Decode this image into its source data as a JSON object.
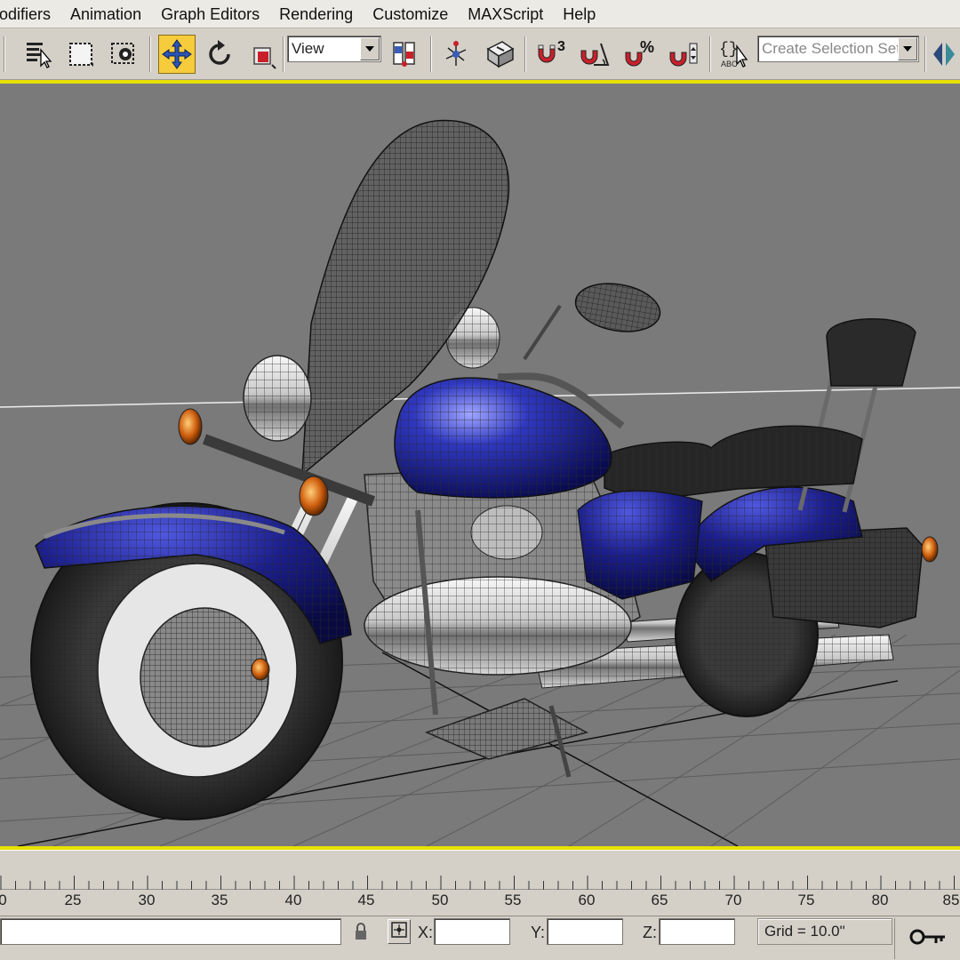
{
  "menu": {
    "items": [
      "odifiers",
      "Animation",
      "Graph Editors",
      "Rendering",
      "Customize",
      "MAXScript",
      "Help"
    ]
  },
  "toolbar": {
    "reference_coord": {
      "value": "View"
    },
    "selection_set": {
      "placeholder": "Create Selection Set"
    },
    "snap_angle_digit": "3",
    "percent_snap_symbol": "%"
  },
  "timeline": {
    "ticks": [
      "0",
      "25",
      "30",
      "35",
      "40",
      "45",
      "50",
      "55",
      "60",
      "65",
      "70",
      "75",
      "80",
      "85"
    ]
  },
  "status": {
    "x_label": "X:",
    "y_label": "Y:",
    "z_label": "Z:",
    "x_value": "",
    "y_value": "",
    "z_value": "",
    "grid": "Grid = 10.0\""
  },
  "colors": {
    "viewport_bg": "#7a7a7a",
    "active_viewport_border": "#e8e000",
    "active_tool": "#f6cc3c",
    "tank_paint": "#1c1f8c"
  },
  "icons": [
    "select-by-name-icon",
    "region-select-icon",
    "window-crossing-icon",
    "move-icon",
    "rotate-icon",
    "scale-icon",
    "pivot-icon",
    "link-icon",
    "manipulate-icon",
    "snap-3d-icon",
    "angle-snap-icon",
    "percent-snap-icon",
    "spinner-snap-icon",
    "named-selection-icon",
    "mirror-icon",
    "lock-icon",
    "absolute-mode-icon",
    "key-icon"
  ]
}
